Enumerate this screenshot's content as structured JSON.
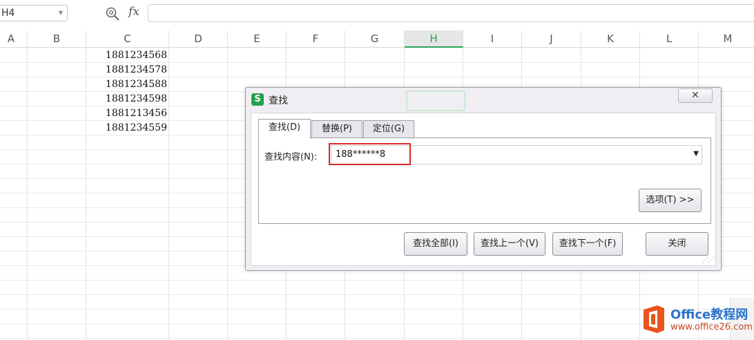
{
  "formula_bar": {
    "name_box": "H4",
    "fx_label": "fx",
    "formula": ""
  },
  "columns": [
    "A",
    "B",
    "C",
    "D",
    "E",
    "F",
    "G",
    "H",
    "I",
    "J",
    "K",
    "L",
    "M"
  ],
  "selected_column": "H",
  "cells_C": [
    "1881234568",
    "1881234578",
    "1881234588",
    "1881234598",
    "1881213456",
    "1881234559"
  ],
  "dialog": {
    "title": "查找",
    "app_icon": "S",
    "close_label": "✕",
    "tabs": [
      {
        "label": "查找(D)"
      },
      {
        "label": "替换(P)"
      },
      {
        "label": "定位(G)"
      }
    ],
    "find_label": "查找内容(N):",
    "find_value": "188******8",
    "options_button": "选项(T) >>",
    "buttons": {
      "find_all": "查找全部(I)",
      "find_prev": "查找上一个(V)",
      "find_next": "查找下一个(F)",
      "close": "关闭"
    }
  },
  "watermark": {
    "line1": "Office教程网",
    "line2": "www.office26.com"
  },
  "colors": {
    "accent_green": "#2aa356",
    "highlight_red": "#d92b2b",
    "wps_green": "#24a150",
    "watermark_orange": "#e8531e",
    "watermark_blue": "#2a72c9"
  }
}
